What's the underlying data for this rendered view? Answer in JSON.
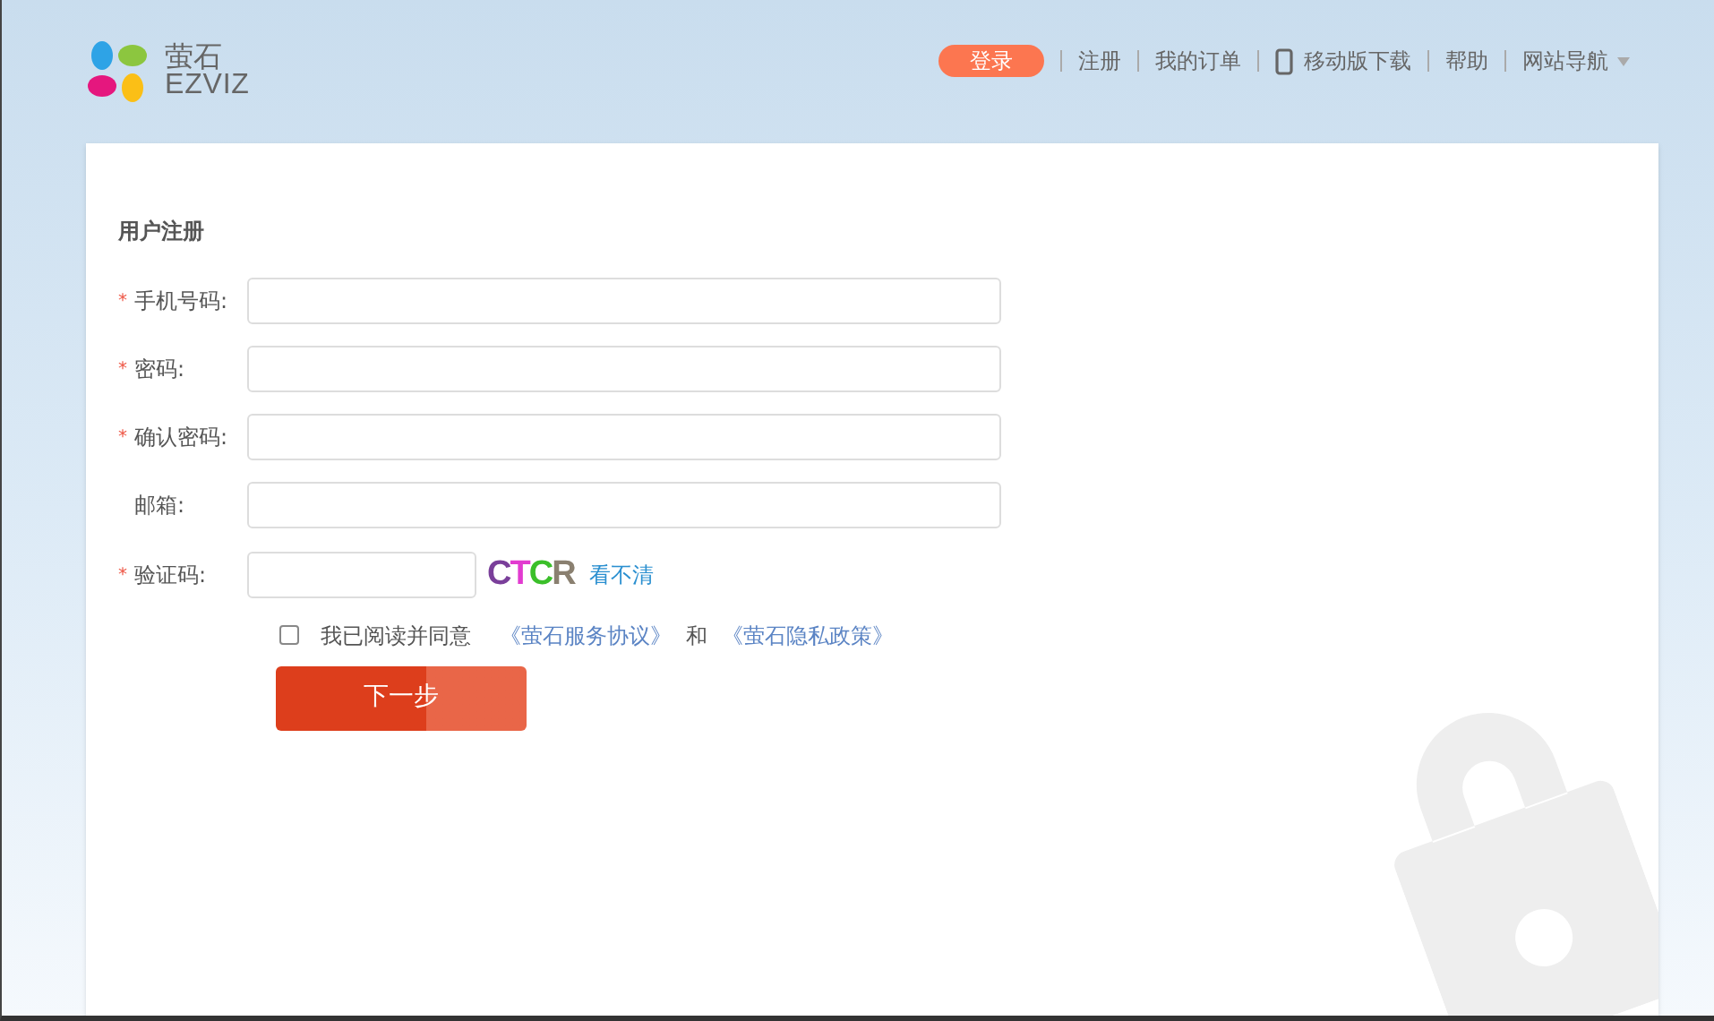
{
  "header": {
    "logo_text": "萤石",
    "logo_subtext": "EZVIZ",
    "nav": [
      {
        "kind": "button",
        "label": "登录"
      },
      {
        "kind": "link",
        "label": "注册"
      },
      {
        "kind": "link",
        "label": "我的订单"
      },
      {
        "kind": "phone",
        "label": "移动版下载"
      },
      {
        "kind": "link",
        "label": "帮助"
      },
      {
        "kind": "dropdown",
        "label": "网站导航"
      }
    ]
  },
  "form": {
    "title": "用户注册",
    "fields": [
      {
        "label": "手机号码:",
        "required_mark": "*",
        "kind": "text"
      },
      {
        "label": "密码:",
        "required_mark": "*",
        "kind": "text"
      },
      {
        "label": "确认密码:",
        "required_mark": "*",
        "kind": "text"
      },
      {
        "label": "邮箱:",
        "kind": "text"
      },
      {
        "label": "验证码:",
        "required_mark": "*",
        "kind": "captcha",
        "captcha_text": "CTCR",
        "refresh_link": "看不清"
      }
    ],
    "agreement": {
      "checked": false,
      "text": "我已阅读并同意",
      "link_1": "《萤石服务协议》",
      "and": "和",
      "link_2": "《萤石隐私政策》"
    },
    "submit": "下一步"
  }
}
